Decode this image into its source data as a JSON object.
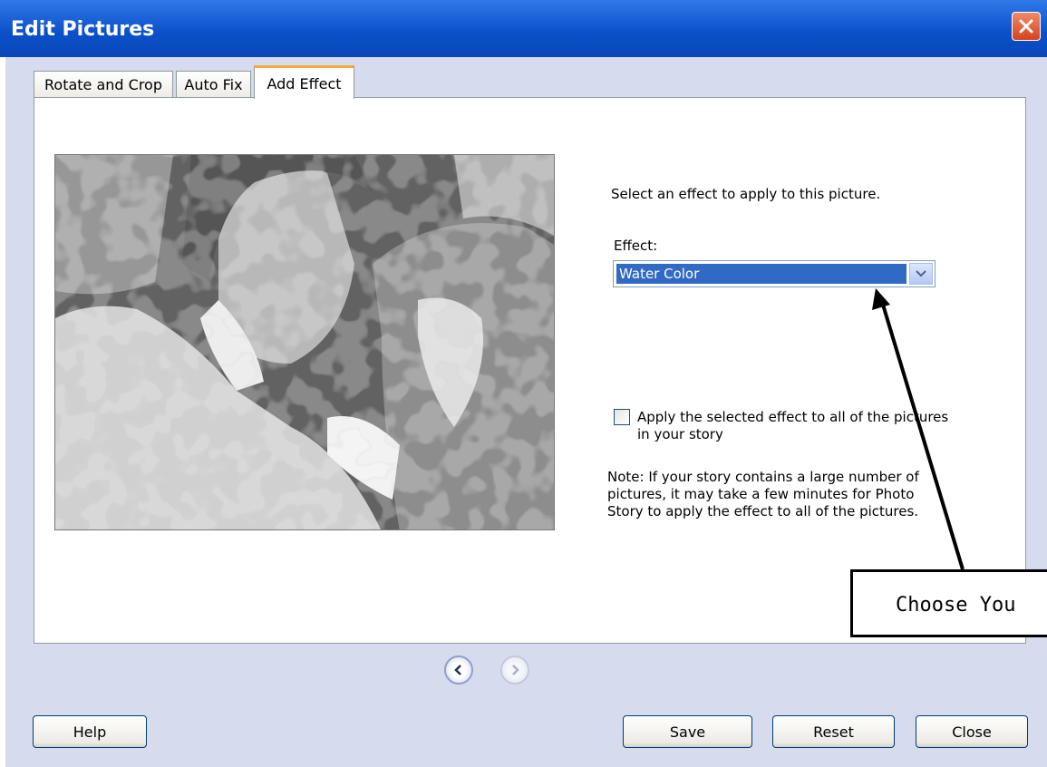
{
  "window": {
    "title": "Edit Pictures"
  },
  "tabs": [
    {
      "label": "Rotate and Crop",
      "active": false
    },
    {
      "label": "Auto Fix",
      "active": false
    },
    {
      "label": "Add Effect",
      "active": true
    }
  ],
  "panel": {
    "instruction": "Select an effect to apply to this picture.",
    "effect_label": "Effect:",
    "effect_value": "Water Color",
    "apply_all_label_line1": "Apply the selected effect to all of the pictures",
    "apply_all_label_line2": "in your story",
    "apply_all_checked": false,
    "note_line1": "Note: If your story contains a large number of",
    "note_line2": "pictures, it may take a few minutes for Photo",
    "note_line3": "Story to apply the effect to all of the pictures."
  },
  "callout": {
    "text": "Choose You"
  },
  "buttons": {
    "help": "Help",
    "save": "Save",
    "reset": "Reset",
    "close": "Close"
  },
  "icons": {
    "close": "close-icon",
    "prev": "chevron-left-icon",
    "next": "chevron-right-icon",
    "dropdown": "chevron-down-icon"
  },
  "colors": {
    "titlebar": "#0b4fc8",
    "selection": "#316ac5",
    "tab_accent": "#f6a93b",
    "dialog_bg": "#d6dbed"
  }
}
